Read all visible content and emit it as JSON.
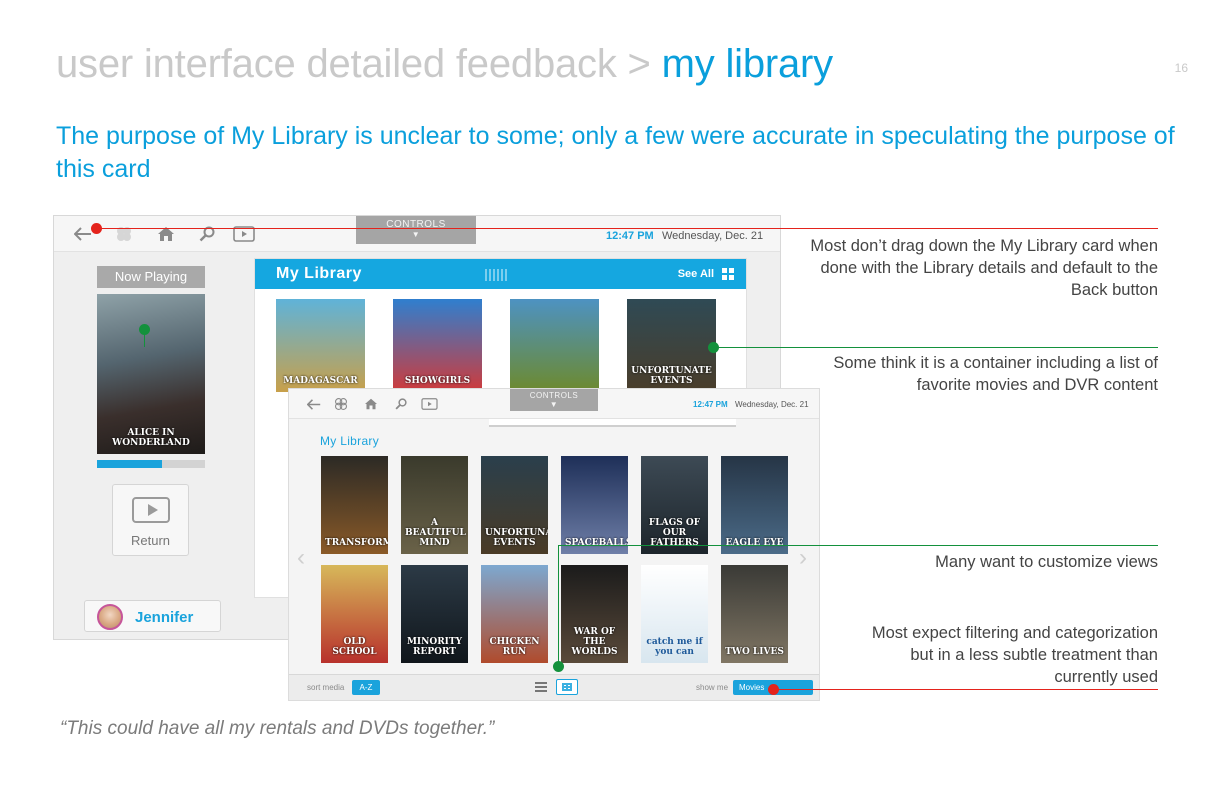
{
  "slide": {
    "title_prefix": "user interface detailed feedback > ",
    "title_highlight": "my library",
    "page_number": "16",
    "subtitle": "The purpose of My Library is unclear to some; only a few were accurate in speculating the purpose of this card",
    "quote": "“This could have all my rentals and DVDs together.”",
    "colors": {
      "accent": "#0a9fdc",
      "annotation_red": "#e4231c",
      "annotation_green": "#13913c"
    }
  },
  "back_screen": {
    "controls_label": "CONTROLS",
    "time": "12:47 PM",
    "date": "Wednesday, Dec. 21",
    "nav_icons": [
      "back-arrow-icon",
      "flower-icon",
      "home-icon",
      "search-icon",
      "play-icon"
    ],
    "now_playing_label": "Now Playing",
    "now_playing_title": "ALICE IN WONDERLAND",
    "playback_progress": 0.6,
    "return_label": "Return",
    "user_name": "Jennifer",
    "library_title": "My Library",
    "see_all_label": "See All",
    "posters": [
      {
        "title": "MADAGASCAR",
        "color_top": "#5fb3d9",
        "color_bottom": "#c8a04a"
      },
      {
        "title": "SHOWGIRLS",
        "color_top": "#2f7fcf",
        "color_bottom": "#d03a3a"
      },
      {
        "title": "",
        "color_top": "#4d92c2",
        "color_bottom": "#6d8a2d"
      },
      {
        "title": "UNFORTUNATE EVENTS",
        "color_top": "#2f4a55",
        "color_bottom": "#4a3d2a"
      }
    ]
  },
  "front_screen": {
    "controls_label": "CONTROLS",
    "time": "12:47 PM",
    "date": "Wednesday, Dec. 21",
    "library_title": "My Library",
    "sort_label": "sort media",
    "sort_value": "A-Z",
    "show_label": "show me",
    "show_value": "Movies",
    "posters_row1": [
      {
        "title": "TRANSFORMERS",
        "color_top": "#2c2a25",
        "color_bottom": "#8a5a28"
      },
      {
        "title": "A BEAUTIFUL MIND",
        "color_top": "#3a3a2c",
        "color_bottom": "#6a6248"
      },
      {
        "title": "UNFORTUNATE EVENTS",
        "color_top": "#2a3f4c",
        "color_bottom": "#4a3b26"
      },
      {
        "title": "SPACEBALLS",
        "color_top": "#1e2f58",
        "color_bottom": "#6f7fa8"
      },
      {
        "title": "FLAGS OF OUR FATHERS",
        "color_top": "#3d4a55",
        "color_bottom": "#1d252b"
      },
      {
        "title": "EAGLE EYE",
        "color_top": "#263546",
        "color_bottom": "#4b6b88"
      }
    ],
    "posters_row2": [
      {
        "title": "OLD SCHOOL",
        "color_top": "#d7b85a",
        "color_bottom": "#b8312c"
      },
      {
        "title": "MINORITY REPORT",
        "color_top": "#2c3a46",
        "color_bottom": "#10161b"
      },
      {
        "title": "CHICKEN RUN",
        "color_top": "#7da8d0",
        "color_bottom": "#b04b2c"
      },
      {
        "title": "WAR OF THE WORLDS",
        "color_top": "#1b1b1b",
        "color_bottom": "#5a4a3a"
      },
      {
        "title": "catch me if you can",
        "color_top": "#ffffff",
        "color_bottom": "#d8e6ef"
      },
      {
        "title": "TWO LIVES",
        "color_top": "#3a3a36",
        "color_bottom": "#807664"
      }
    ]
  },
  "annotations": [
    {
      "text": "Most don’t drag down the My Library card when done with the Library details and default to the Back button",
      "color": "#e4231c"
    },
    {
      "text": "Some think it is a container including a list of favorite movies and DVR content",
      "color": "#13913c"
    },
    {
      "text": "Many want to customize views",
      "color": "#13913c"
    },
    {
      "text": "Most expect filtering and categorization but in a less subtle treatment than currently used",
      "color": "#e4231c"
    }
  ]
}
